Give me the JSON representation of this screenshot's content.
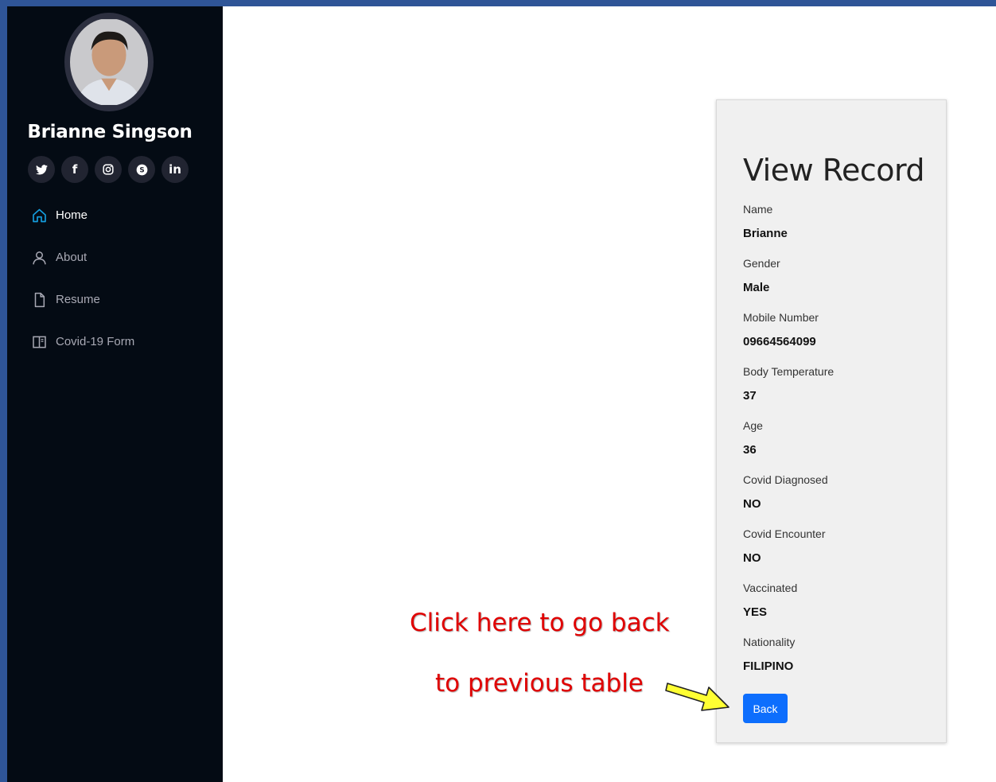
{
  "profile": {
    "name": "Brianne Singson"
  },
  "social": [
    {
      "icon": "twitter-icon",
      "glyph": "🐦"
    },
    {
      "icon": "facebook-icon",
      "glyph": "f"
    },
    {
      "icon": "instagram-icon",
      "glyph": "◎"
    },
    {
      "icon": "skype-icon",
      "glyph": "S"
    },
    {
      "icon": "linkedin-icon",
      "glyph": "in"
    }
  ],
  "nav": [
    {
      "label": "Home",
      "icon": "home-icon",
      "active": true
    },
    {
      "label": "About",
      "icon": "person-icon",
      "active": false
    },
    {
      "label": "Resume",
      "icon": "file-icon",
      "active": false
    },
    {
      "label": "Covid-19 Form",
      "icon": "book-icon",
      "active": false
    }
  ],
  "record": {
    "title": "View Record",
    "fields": [
      {
        "label": "Name",
        "value": "Brianne"
      },
      {
        "label": "Gender",
        "value": "Male"
      },
      {
        "label": "Mobile Number",
        "value": "09664564099"
      },
      {
        "label": "Body Temperature",
        "value": "37"
      },
      {
        "label": "Age",
        "value": "36"
      },
      {
        "label": "Covid Diagnosed",
        "value": "NO"
      },
      {
        "label": "Covid Encounter",
        "value": "NO"
      },
      {
        "label": "Vaccinated",
        "value": "YES"
      },
      {
        "label": "Nationality",
        "value": "FILIPINO"
      }
    ],
    "back_label": "Back"
  },
  "annotation": {
    "line1": "Click here to go back",
    "line2": "to previous table",
    "color": "#e00000",
    "arrow_color": "#ffff33"
  }
}
